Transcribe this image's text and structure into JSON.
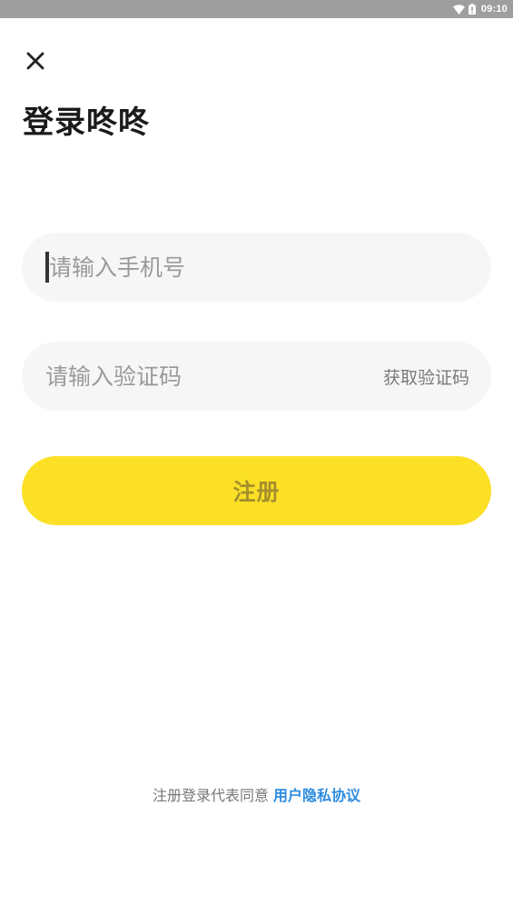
{
  "status_bar": {
    "time": "09:10",
    "wifi_icon": "wifi-icon",
    "battery_icon": "battery-icon"
  },
  "close_icon": "close-icon",
  "title": "登录咚咚",
  "phone_field": {
    "placeholder": "请输入手机号",
    "value": ""
  },
  "code_field": {
    "placeholder": "请输入验证码",
    "value": "",
    "get_code_label": "获取验证码"
  },
  "register_label": "注册",
  "agreement": {
    "text": "注册登录代表同意",
    "link": "用户隐私协议"
  },
  "colors": {
    "accent_yellow": "#fce025",
    "button_text": "#a58f2d",
    "link_blue": "#2d8ce0",
    "field_bg": "#f6f6f6"
  }
}
